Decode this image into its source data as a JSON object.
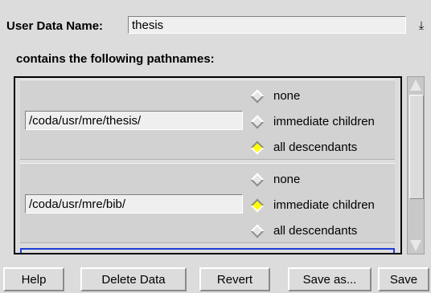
{
  "header": {
    "name_label": "User Data Name:",
    "name_value": "thesis",
    "dropdown_glyph": "⤓",
    "contains_label": "contains the following pathnames:"
  },
  "entries": [
    {
      "path": "/coda/usr/mre/thesis/",
      "options": [
        "none",
        "immediate children",
        "all descendants"
      ],
      "selected": "all descendants"
    },
    {
      "path": "/coda/usr/mre/bib/",
      "options": [
        "none",
        "immediate children",
        "all descendants"
      ],
      "selected": "immediate children"
    }
  ],
  "buttons": {
    "help": "Help",
    "delete": "Delete Data",
    "revert": "Revert",
    "save_as": "Save as...",
    "save": "Save"
  },
  "colors": {
    "selected_radio": "#ffff00",
    "focus_border": "#1f3fd6"
  },
  "icons": [
    "dropdown-arrow-icon",
    "radio-diamond-icon",
    "scroll-up-arrow-icon",
    "scroll-down-arrow-icon"
  ]
}
